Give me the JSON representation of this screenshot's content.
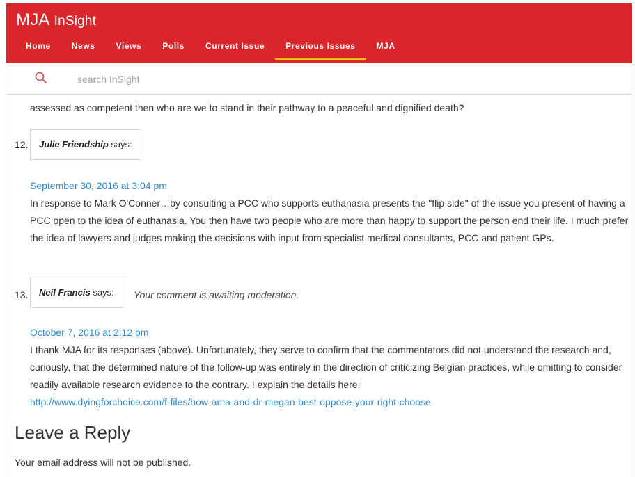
{
  "brand": {
    "main": "MJA",
    "sub": "InSight"
  },
  "nav": {
    "items": [
      "Home",
      "News",
      "Views",
      "Polls",
      "Current Issue",
      "Previous Issues",
      "MJA"
    ],
    "active": "Previous Issues",
    "accent_color": "#d9262b",
    "active_underline_color": "#f3c21a"
  },
  "search": {
    "placeholder": "search InSight",
    "icon": "search-icon"
  },
  "lead_text": "assessed as competent then who are we to stand in their pathway to a peaceful and dignified death?",
  "comments": [
    {
      "number": "12.",
      "author": "Julie Friendship",
      "says": "says:",
      "moderation": "",
      "date": "September 30, 2016 at 3:04 pm",
      "body": "In response to Mark O'Conner…by consulting a PCC who supports euthanasia presents the \"flip side\" of the issue you present of having a PCC open to the idea of euthanasia. You then have two people who are more than happy to support the person end their life. I much prefer the idea of lawyers and judges making the decisions with input from specialist medical consultants, PCC and patient GPs."
    },
    {
      "number": "13.",
      "author": "Neil Francis",
      "says": "says:",
      "moderation": "Your comment is awaiting moderation.",
      "date": "October 7, 2016 at 2:12 pm",
      "body": "I thank MJA for its responses (above). Unfortunately, they serve to confirm that the commentators did not understand the research and, curiously, that the determined nature of the follow-up was entirely in the direction of criticizing Belgian practices, while omitting to consider readily available research evidence to the contrary. I explain the details here:",
      "link": "http://www.dyingforchoice.com/f-files/how-ama-and-dr-megan-best-oppose-your-right-choose"
    }
  ],
  "reply": {
    "title": "Leave a Reply",
    "note": "Your email address will not be published."
  },
  "colors": {
    "link": "#2b8bd6",
    "text": "#333333"
  }
}
